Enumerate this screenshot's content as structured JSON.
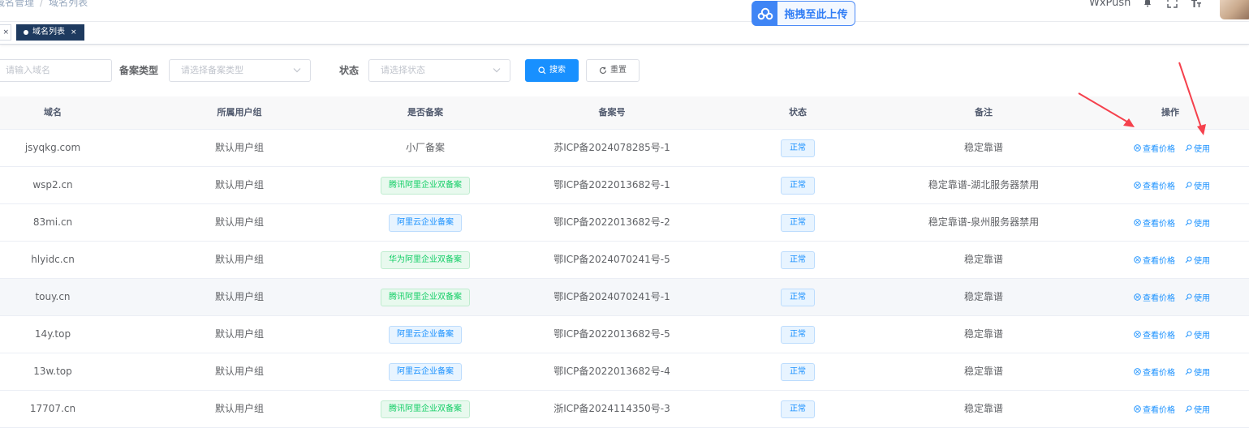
{
  "breadcrumb": {
    "parent": "域名管理",
    "current": "域名列表"
  },
  "upload": {
    "label": "拖拽至此上传"
  },
  "header": {
    "username": "WxPush"
  },
  "tags": {
    "active_label": "域名列表",
    "close": "×",
    "prev_close": "×"
  },
  "filters": {
    "domain_placeholder": "请输入域名",
    "record_type_label": "备案类型",
    "record_type_placeholder": "请选择备案类型",
    "status_label": "状态",
    "status_placeholder": "请选择状态",
    "search_label": "搜索",
    "reset_label": "重置"
  },
  "table": {
    "headers": {
      "domain": "域名",
      "group": "所属用户组",
      "record": "是否备案",
      "icp": "备案号",
      "status": "状态",
      "remark": "备注",
      "ops": "操作"
    },
    "op_view_price": "查看价格",
    "op_use": "使用",
    "rows": [
      {
        "domain": "jsyqkg.com",
        "group": "默认用户组",
        "record": "小厂备案",
        "record_style": "plain",
        "icp": "苏ICP备2024078285号-1",
        "status": "正常",
        "remark": "稳定靠谱"
      },
      {
        "domain": "wsp2.cn",
        "group": "默认用户组",
        "record": "腾讯阿里企业双备案",
        "record_style": "green",
        "icp": "鄂ICP备2022013682号-1",
        "status": "正常",
        "remark": "稳定靠谱-湖北服务器禁用"
      },
      {
        "domain": "83mi.cn",
        "group": "默认用户组",
        "record": "阿里云企业备案",
        "record_style": "blue",
        "icp": "鄂ICP备2022013682号-2",
        "status": "正常",
        "remark": "稳定靠谱-泉州服务器禁用"
      },
      {
        "domain": "hlyidc.cn",
        "group": "默认用户组",
        "record": "华为阿里企业双备案",
        "record_style": "green",
        "icp": "鄂ICP备2024070241号-5",
        "status": "正常",
        "remark": "稳定靠谱"
      },
      {
        "domain": "touy.cn",
        "group": "默认用户组",
        "record": "腾讯阿里企业双备案",
        "record_style": "green",
        "icp": "鄂ICP备2024070241号-1",
        "status": "正常",
        "remark": "稳定靠谱"
      },
      {
        "domain": "14y.top",
        "group": "默认用户组",
        "record": "阿里云企业备案",
        "record_style": "blue",
        "icp": "鄂ICP备2022013682号-5",
        "status": "正常",
        "remark": "稳定靠谱"
      },
      {
        "domain": "13w.top",
        "group": "默认用户组",
        "record": "阿里云企业备案",
        "record_style": "blue",
        "icp": "鄂ICP备2022013682号-4",
        "status": "正常",
        "remark": "稳定靠谱"
      },
      {
        "domain": "17707.cn",
        "group": "默认用户组",
        "record": "腾讯阿里企业双备案",
        "record_style": "green",
        "icp": "浙ICP备2024114350号-3",
        "status": "正常",
        "remark": "稳定靠谱"
      }
    ]
  },
  "colors": {
    "primary": "#1890ff",
    "success": "#13ce66",
    "annotation": "#f5414d",
    "tag_active": "#1e3a5f"
  },
  "icons": [
    "cloud-upload-icon",
    "bell-icon",
    "fullscreen-icon",
    "font-size-icon",
    "search-icon",
    "refresh-icon",
    "chevron-down-icon",
    "view-price-icon",
    "use-icon",
    "arrow-annotation"
  ]
}
